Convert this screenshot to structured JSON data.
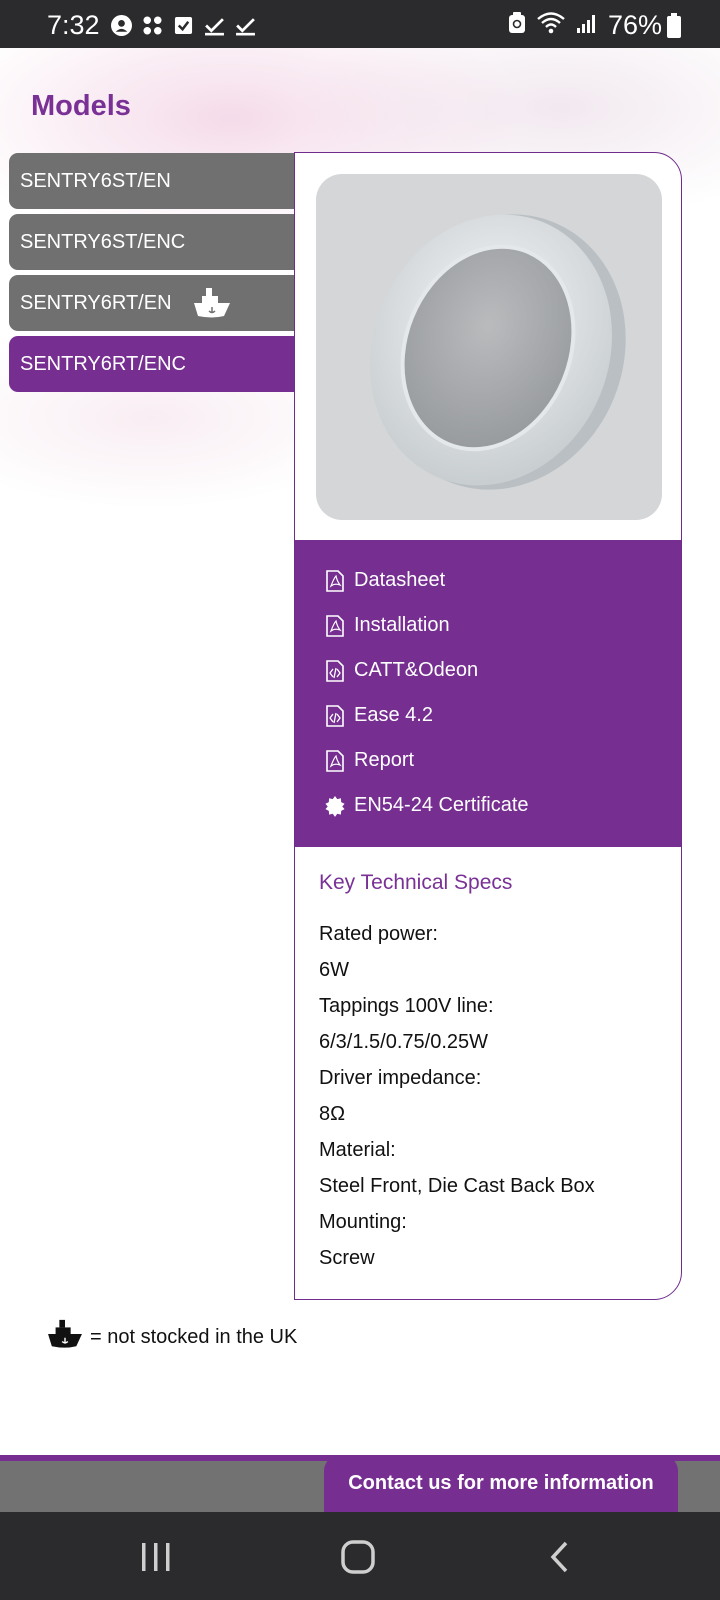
{
  "status_bar": {
    "time": "7:32",
    "battery": "76%",
    "icons_left": [
      "account-icon",
      "grid-apps-icon",
      "checkbox-icon",
      "check-icon",
      "check-icon"
    ],
    "icons_right": [
      "recycle-icon",
      "wifi-icon",
      "signal-icon",
      "battery-icon"
    ]
  },
  "page": {
    "title": "Models",
    "accent_color": "#762e91",
    "tab_color": "#707070"
  },
  "models": [
    {
      "label": "SENTRY6ST/EN",
      "active": false,
      "not_stocked_uk": false
    },
    {
      "label": "SENTRY6ST/ENC",
      "active": false,
      "not_stocked_uk": false
    },
    {
      "label": "SENTRY6RT/EN",
      "active": false,
      "not_stocked_uk": true
    },
    {
      "label": "SENTRY6RT/ENC",
      "active": true,
      "not_stocked_uk": false
    }
  ],
  "documents": [
    {
      "label": "Datasheet",
      "icon": "pdf-icon"
    },
    {
      "label": "Installation",
      "icon": "pdf-icon"
    },
    {
      "label": "CATT&Odeon",
      "icon": "code-file-icon"
    },
    {
      "label": "Ease 4.2",
      "icon": "code-file-icon"
    },
    {
      "label": "Report",
      "icon": "pdf-icon"
    },
    {
      "label": "EN54-24 Certificate",
      "icon": "certificate-badge-icon"
    }
  ],
  "specs": {
    "title": "Key Technical Specs",
    "items": [
      {
        "label": "Rated power:",
        "value": "6W"
      },
      {
        "label": "Tappings 100V line:",
        "value": "6/3/1.5/0.75/0.25W"
      },
      {
        "label": "Driver impedance:",
        "value": "8Ω"
      },
      {
        "label": "Material:",
        "value": "Steel Front, Die Cast Back Box"
      },
      {
        "label": "Mounting:",
        "value": "Screw"
      }
    ]
  },
  "legend": {
    "text": "= not stocked in the UK",
    "icon": "ship-icon"
  },
  "footer": {
    "contact_label": "Contact us for more information"
  },
  "nav_bar": {
    "buttons": [
      "recent-apps-icon",
      "home-icon",
      "back-icon"
    ]
  }
}
